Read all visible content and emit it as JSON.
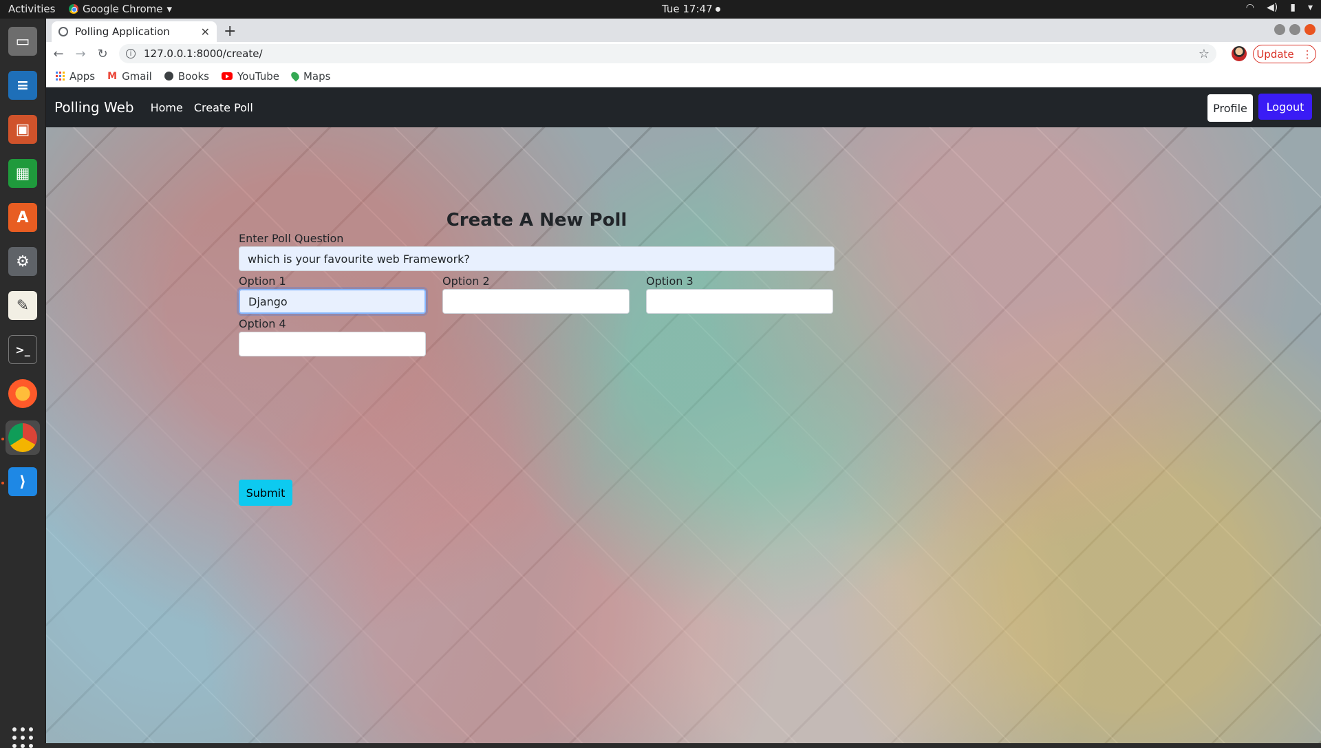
{
  "system": {
    "activities": "Activities",
    "app_name": "Google Chrome",
    "clock": "Tue 17:47"
  },
  "browser": {
    "tab_title": "Polling Application",
    "url": "127.0.0.1:8000/create/",
    "update_label": "Update",
    "bookmarks": [
      "Apps",
      "Gmail",
      "Books",
      "YouTube",
      "Maps"
    ]
  },
  "navbar": {
    "brand": "Polling Web",
    "links": [
      "Home",
      "Create Poll"
    ],
    "profile_label": "Profile",
    "logout_label": "Logout"
  },
  "form": {
    "title": "Create A New Poll",
    "question_label": "Enter Poll Question",
    "question_value": "which is your favourite web Framework?",
    "option1_label": "Option 1",
    "option1_value": "Django",
    "option2_label": "Option 2",
    "option2_value": "",
    "option3_label": "Option 3",
    "option3_value": "",
    "option4_label": "Option 4",
    "option4_value": "",
    "submit_label": "Submit"
  },
  "colors": {
    "navbar_bg": "#212529",
    "logout_bg": "#3a1cf5",
    "submit_bg": "#0dcaf0"
  }
}
